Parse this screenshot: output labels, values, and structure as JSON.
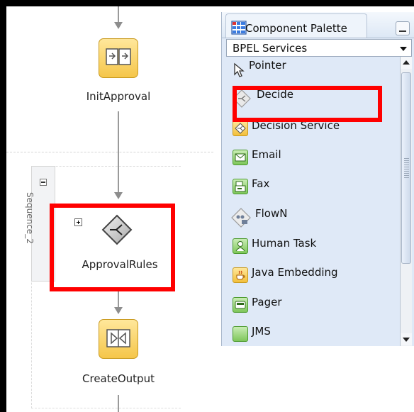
{
  "diagram": {
    "nodes": [
      {
        "label": "InitApproval",
        "icon": "assign-icon"
      },
      {
        "label": "ApprovalRules",
        "icon": "decide-icon"
      },
      {
        "label": "CreateOutput",
        "icon": "transform-icon"
      }
    ],
    "sequence_label": "Sequence_2"
  },
  "palette": {
    "title": "Component Palette",
    "category": "BPEL Services",
    "items": [
      {
        "label": "Pointer",
        "icon": "pointer-icon"
      },
      {
        "label": "Decide",
        "icon": "decide-icon"
      },
      {
        "label": "Decision Service",
        "icon": "decision-service-icon"
      },
      {
        "label": "Email",
        "icon": "email-icon"
      },
      {
        "label": "Fax",
        "icon": "fax-icon"
      },
      {
        "label": "FlowN",
        "icon": "flown-icon"
      },
      {
        "label": "Human Task",
        "icon": "human-task-icon"
      },
      {
        "label": "Java Embedding",
        "icon": "java-embedding-icon"
      },
      {
        "label": "Pager",
        "icon": "pager-icon"
      },
      {
        "label": "JMS",
        "icon": "jms-icon"
      }
    ]
  },
  "colors": {
    "highlight": "#ff0000",
    "activity_fill": "#f5c64a",
    "palette_bg": "#dfe9f7"
  }
}
